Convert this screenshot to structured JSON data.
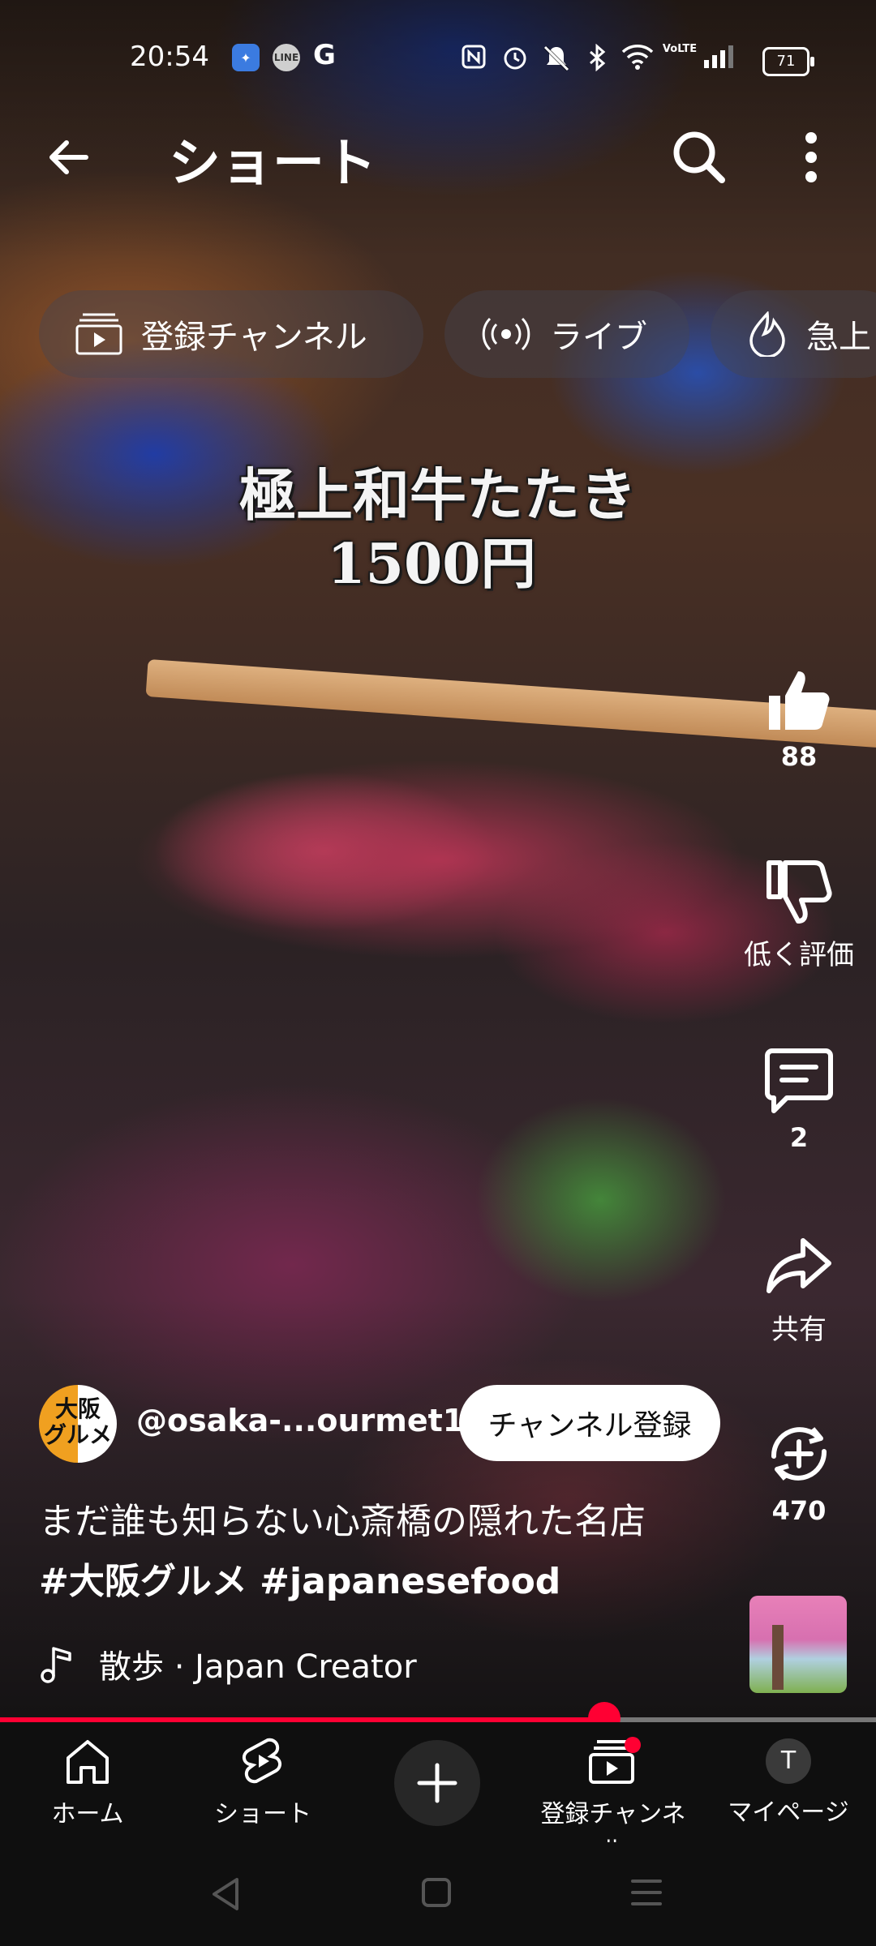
{
  "status_bar": {
    "time": "20:54",
    "notification_apps": [
      "app-icon",
      "LINE",
      "G"
    ],
    "battery": "71",
    "network": "VoLTE"
  },
  "top_bar": {
    "title": "ショート"
  },
  "chips": [
    {
      "label": "登録チャンネル",
      "icon": "subscriptions-icon"
    },
    {
      "label": "ライブ",
      "icon": "live-icon"
    },
    {
      "label": "急上",
      "icon": "trending-icon"
    }
  ],
  "video": {
    "caption_line1": "極上和牛たたき",
    "caption_line2": "1500円"
  },
  "actions": {
    "like_count": "88",
    "dislike_label": "低く評価",
    "comment_count": "2",
    "share_label": "共有",
    "remix_count": "470"
  },
  "channel": {
    "avatar_text_line1": "大阪",
    "avatar_text_line2": "グルメ",
    "name": "@osaka-...ourmet1",
    "subscribe_label": "チャンネル登録"
  },
  "description": {
    "line1": "まだ誰も知らない心斎橋の隠れた名店",
    "line2": "#大阪グルメ #japanesefood"
  },
  "music": {
    "text": "散歩 · Japan Creator"
  },
  "progress": {
    "fraction": 0.69
  },
  "bottom_nav": {
    "home": "ホーム",
    "shorts": "ショート",
    "subscriptions": "登録チャンネル",
    "mypage": "マイページ",
    "mypage_avatar": "T"
  },
  "colors": {
    "accent_red": "#ff0033",
    "nav_background": "#0f0f0f"
  }
}
